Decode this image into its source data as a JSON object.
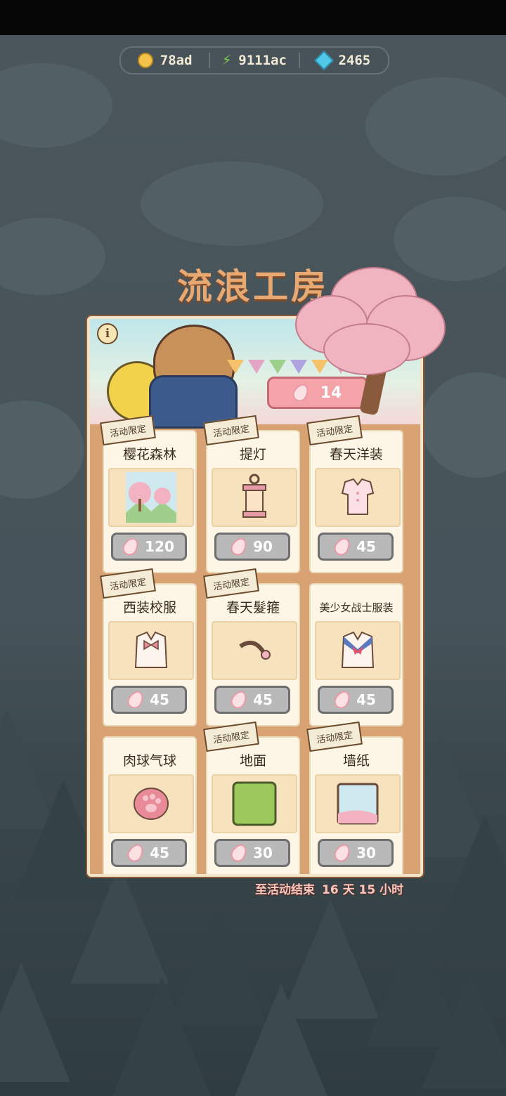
{
  "currency": {
    "coins": "78ad",
    "energy": "9111ac",
    "gems": "2465"
  },
  "shop": {
    "title": "流浪工房",
    "petal_count": "14",
    "ribbon_label": "活动限定",
    "items": [
      {
        "name": "樱花森林",
        "price": "120",
        "icon": "sakura-forest-icon"
      },
      {
        "name": "提灯",
        "price": "90",
        "icon": "lantern-icon"
      },
      {
        "name": "春天洋装",
        "price": "45",
        "icon": "spring-dress-icon"
      },
      {
        "name": "西装校服",
        "price": "45",
        "icon": "school-uniform-icon"
      },
      {
        "name": "春天髮箍",
        "price": "45",
        "icon": "hairband-icon"
      },
      {
        "name": "美少女战士服装",
        "price": "45",
        "icon": "sailor-outfit-icon"
      },
      {
        "name": "肉球气球",
        "price": "45",
        "icon": "paw-balloon-icon"
      },
      {
        "name": "地面",
        "price": "30",
        "icon": "ground-icon"
      },
      {
        "name": "墙纸",
        "price": "30",
        "icon": "wallpaper-icon"
      }
    ]
  },
  "countdown": {
    "label": "至活动结束",
    "remaining": "16 天 15 小时"
  },
  "colors": {
    "title": "#e8a871",
    "petal_badge": "#f4a3a8",
    "price_button": "#b9b9b9"
  }
}
